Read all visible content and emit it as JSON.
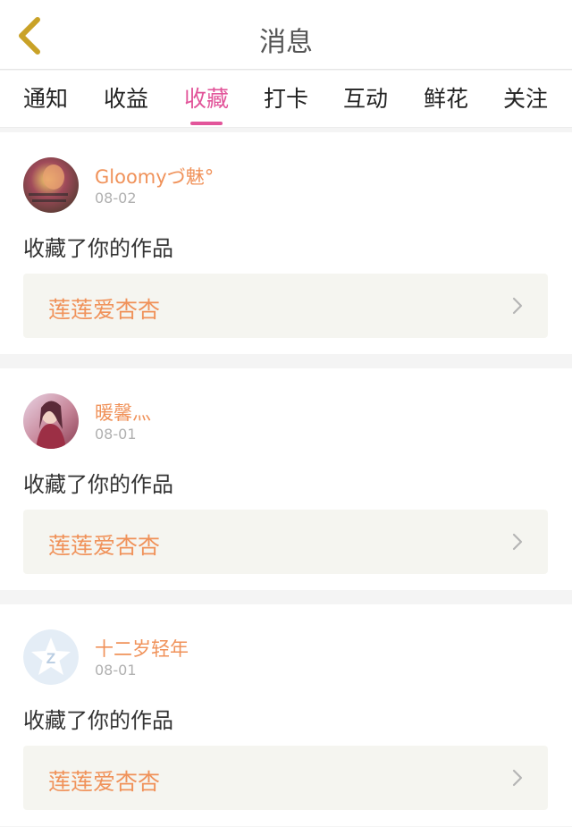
{
  "header": {
    "title": "消息"
  },
  "tabs": [
    {
      "label": "通知",
      "active": false
    },
    {
      "label": "收益",
      "active": false
    },
    {
      "label": "收藏",
      "active": true
    },
    {
      "label": "打卡",
      "active": false
    },
    {
      "label": "互动",
      "active": false
    },
    {
      "label": "鲜花",
      "active": false
    },
    {
      "label": "关注",
      "active": false
    }
  ],
  "messages": [
    {
      "user": "Gloomyづ魅°",
      "date": "08-02",
      "action": "收藏了你的作品",
      "work_title": "莲莲爱杏杏"
    },
    {
      "user": "暖馨灬",
      "date": "08-01",
      "action": "收藏了你的作品",
      "work_title": "莲莲爱杏杏"
    },
    {
      "user": "十二岁轻年",
      "date": "08-01",
      "action": "收藏了你的作品",
      "work_title": "莲莲爱杏杏"
    }
  ],
  "colors": {
    "accent": "#e2559a",
    "username": "#f0925a",
    "back_icon": "#c9a227"
  }
}
